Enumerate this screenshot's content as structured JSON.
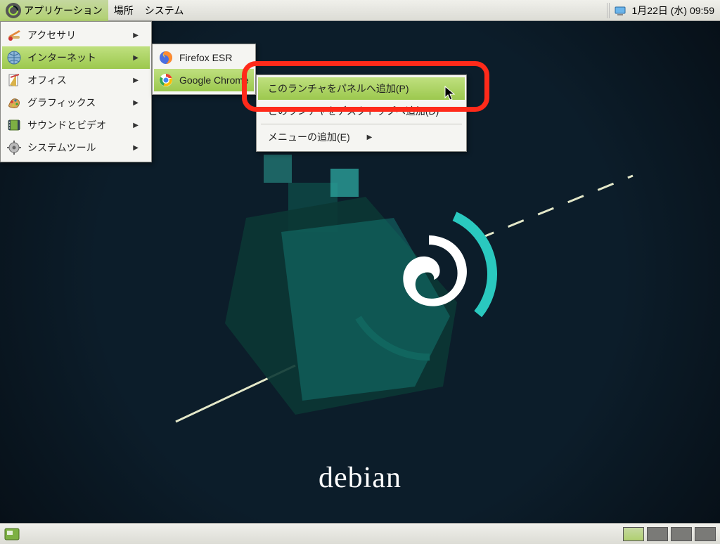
{
  "panel": {
    "apps": "アプリケーション",
    "places": "場所",
    "system": "システム",
    "datetime": "1月22日 (水) 09:59"
  },
  "appsMenu": {
    "items": [
      {
        "label": "アクセサリ"
      },
      {
        "label": "インターネット"
      },
      {
        "label": "オフィス"
      },
      {
        "label": "グラフィックス"
      },
      {
        "label": "サウンドとビデオ"
      },
      {
        "label": "システムツール"
      }
    ]
  },
  "internetMenu": {
    "items": [
      {
        "label": "Firefox ESR"
      },
      {
        "label": "Google Chrome"
      }
    ]
  },
  "contextMenu": {
    "addPanel": "このランチャをパネルへ追加(P)",
    "addDesktop": "このランチャをデスクトップへ追加(D)",
    "addMenu": "メニューの追加(E)"
  },
  "wallpaper": {
    "brand": "debian"
  }
}
